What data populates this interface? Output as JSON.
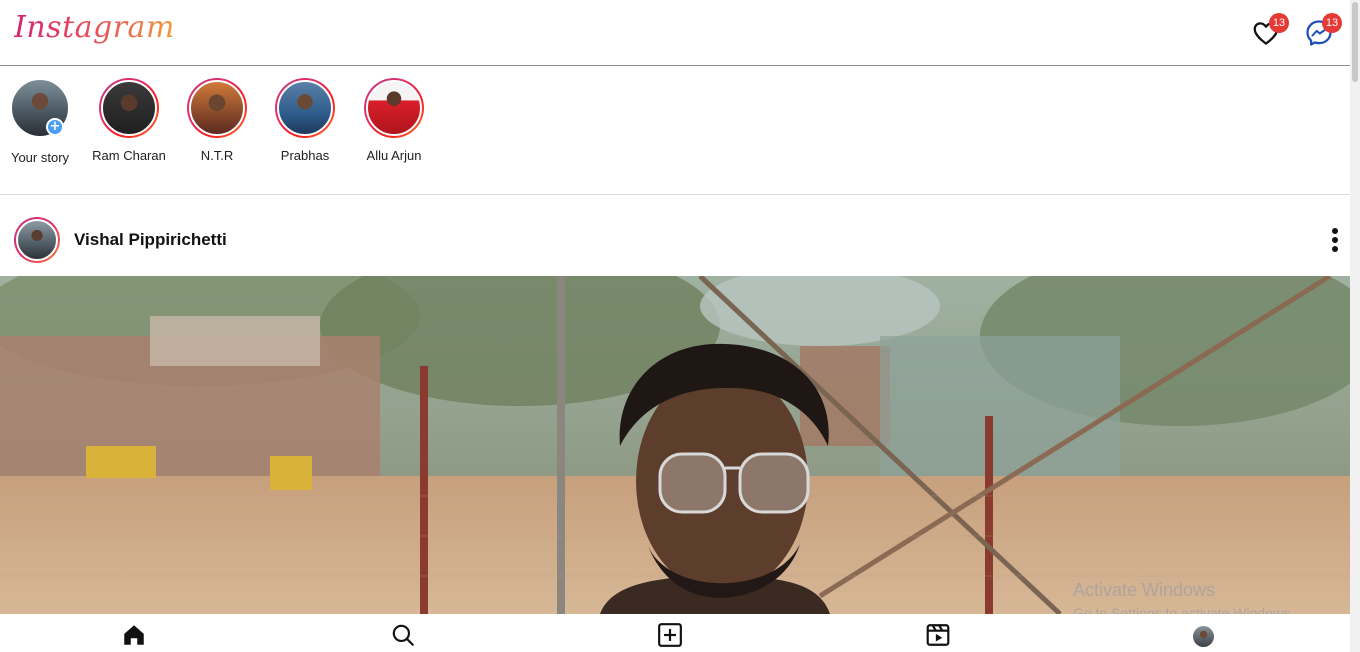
{
  "header": {
    "logo_text": "Instagram",
    "notifications": {
      "icon": "heart-icon",
      "count": "13"
    },
    "messages": {
      "icon": "messenger-icon",
      "count": "13"
    }
  },
  "stories": [
    {
      "label": "Your story",
      "own": true
    },
    {
      "label": "Ram Charan"
    },
    {
      "label": "N.T.R"
    },
    {
      "label": "Prabhas"
    },
    {
      "label": "Allu Arjun"
    }
  ],
  "post": {
    "username": "Vishal Pippirichetti",
    "menu_icon": "more-vertical-icon"
  },
  "bottom_nav": {
    "items": [
      "home-icon",
      "search-icon",
      "create-post-icon",
      "reels-icon",
      "profile-avatar"
    ]
  },
  "watermark": {
    "line1": "Activate Windows",
    "line2": "Go to Settings to activate Windows."
  },
  "colors": {
    "badge": "#e53935",
    "story_ring_start": "#c13584",
    "story_ring_end": "#f77737",
    "add_story": "#4a9cf5"
  }
}
